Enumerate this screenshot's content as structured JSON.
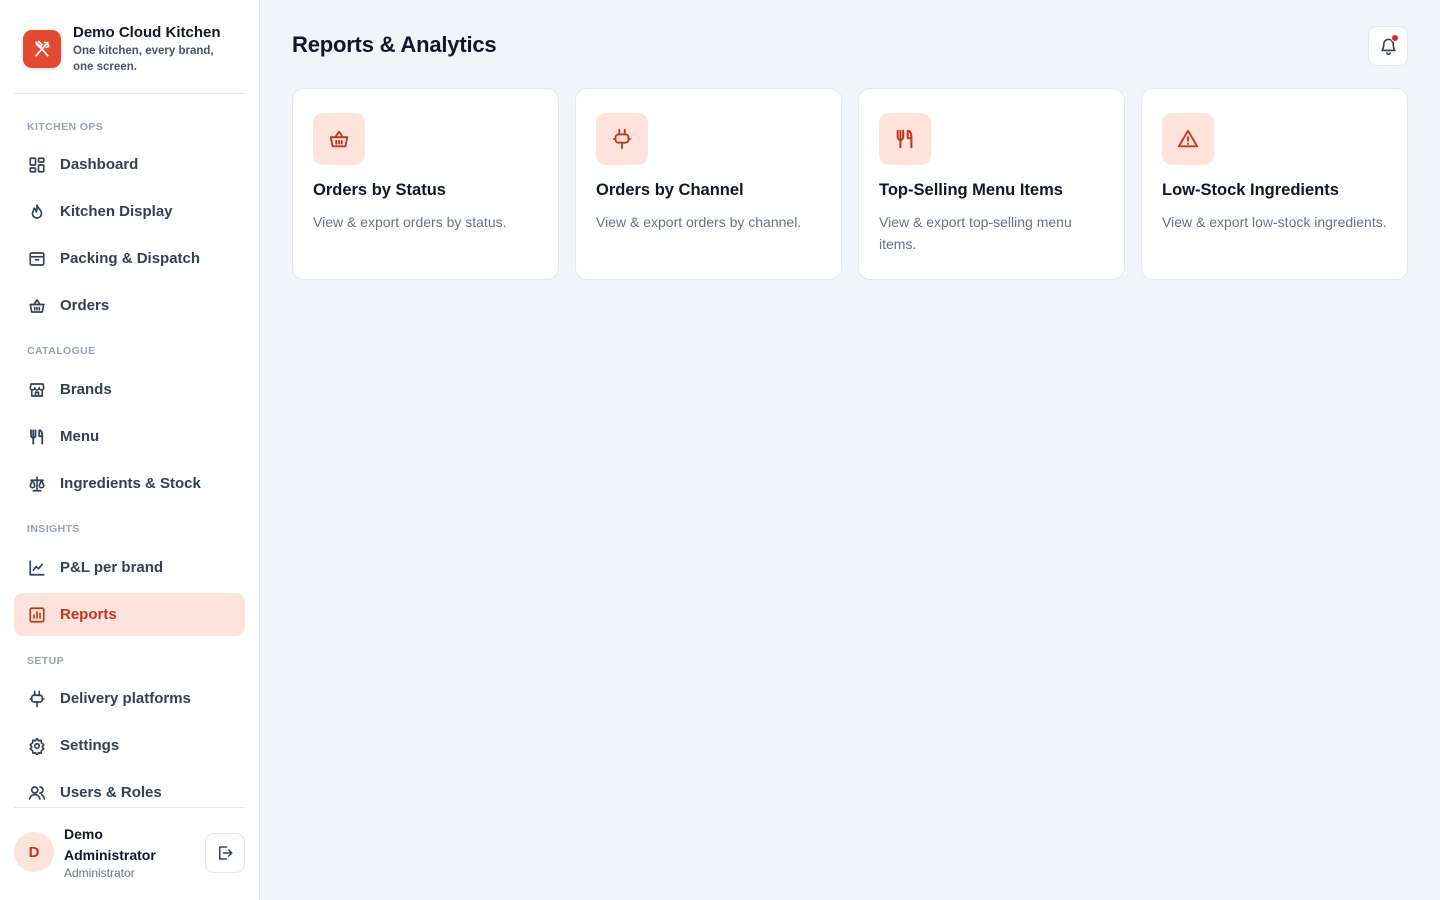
{
  "app": {
    "name": "Demo Cloud Kitchen",
    "tagline": "One kitchen, every brand, one screen."
  },
  "sidebar": {
    "sections": [
      {
        "label": "Kitchen Ops"
      },
      {
        "label": "Catalogue"
      },
      {
        "label": "Insights"
      },
      {
        "label": "Setup"
      }
    ],
    "items": [
      {
        "label": "Dashboard",
        "icon": "dashboard-icon"
      },
      {
        "label": "Kitchen Display",
        "icon": "flame-icon"
      },
      {
        "label": "Packing & Dispatch",
        "icon": "archive-box-icon"
      },
      {
        "label": "Orders",
        "icon": "basket-icon"
      },
      {
        "label": "Brands",
        "icon": "storefront-icon"
      },
      {
        "label": "Menu",
        "icon": "fork-knife-icon"
      },
      {
        "label": "Ingredients & Stock",
        "icon": "scale-icon"
      },
      {
        "label": "P&L per brand",
        "icon": "line-chart-icon"
      },
      {
        "label": "Reports",
        "icon": "bar-chart-icon",
        "active": true
      },
      {
        "label": "Delivery platforms",
        "icon": "plug-icon"
      },
      {
        "label": "Settings",
        "icon": "gear-icon"
      },
      {
        "label": "Users & Roles",
        "icon": "users-icon"
      }
    ]
  },
  "user": {
    "initial": "D",
    "name": "Demo Administrator",
    "role": "Administrator"
  },
  "header": {
    "title": "Reports & Analytics"
  },
  "reports": [
    {
      "title": "Orders by Status",
      "description": "View & export orders by status.",
      "icon": "basket-icon"
    },
    {
      "title": "Orders by Channel",
      "description": "View & export orders by channel.",
      "icon": "plug-icon"
    },
    {
      "title": "Top-Selling Menu Items",
      "description": "View & export top-selling menu items.",
      "icon": "fork-knife-icon"
    },
    {
      "title": "Low-Stock Ingredients",
      "description": "View & export low-stock ingredients.",
      "icon": "warning-triangle-icon"
    }
  ],
  "colors": {
    "accent": "#c2361f",
    "accent_bg": "#fde3dc",
    "logo": "#e34a32",
    "background": "#f1f4f9",
    "notification": "#dc2626"
  }
}
